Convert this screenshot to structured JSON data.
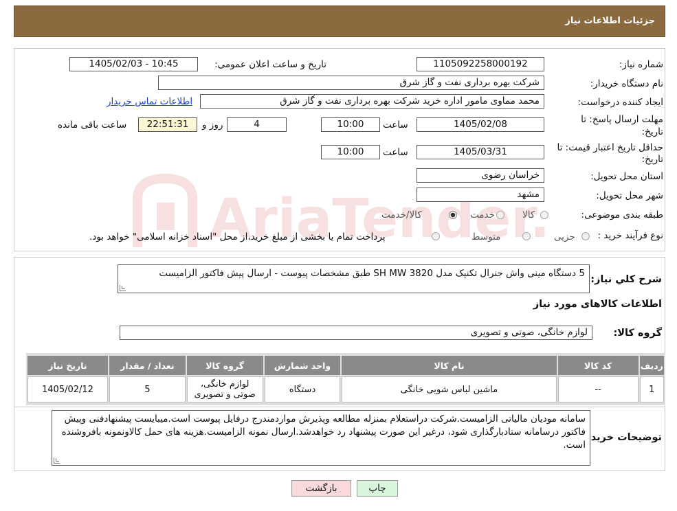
{
  "header": {
    "title": "جزئیات اطلاعات نیاز"
  },
  "watermark": {
    "text": "AriaTender.neT"
  },
  "form": {
    "need_number_label": "شماره نیاز:",
    "need_number": "1105092258000192",
    "announce_label": "تاریخ و ساعت اعلان عمومی:",
    "announce_value": "1405/02/03 - 10:45",
    "buyer_org_label": "نام دستگاه خریدار:",
    "buyer_org": "شرکت بهره برداری نفت و گاز شرق",
    "creator_label": "ایجاد کننده درخواست:",
    "creator": "محمد مماوی مامور اداره خرید شرکت بهره برداری نفت و گاز شرق",
    "contact_link": "اطلاعات تماس خریدار",
    "reply_deadline_label_1": "مهلت ارسال پاسخ: تا",
    "reply_deadline_label_2": "تاریخ:",
    "reply_date": "1405/02/08",
    "time_label": "ساعت",
    "reply_time": "10:00",
    "days_value": "4",
    "days_label": "روز و",
    "remaining_time": "22:51:31",
    "remaining_label": "ساعت باقی مانده",
    "validity_label_1": "حداقل تاریخ اعتبار قیمت: تا",
    "validity_label_2": "تاریخ:",
    "validity_date": "1405/03/31",
    "validity_time": "10:00",
    "province_label": "استان محل تحویل:",
    "province": "خراسان رضوی",
    "city_label": "شهر محل تحویل:",
    "city": "مشهد",
    "category_label": "طبقه بندی موضوعی:",
    "category_options": [
      "کالا",
      "خدمت",
      "کالا/خدمت"
    ],
    "process_label": "نوع فرآیند خرید :",
    "process_options": [
      "جزیی",
      "متوسط"
    ],
    "process_note": "پرداخت تمام یا بخشی از مبلغ خرید،از محل \"اسناد خزانه اسلامی\" خواهد بود."
  },
  "description": {
    "label": "شرح کلي نياز:",
    "text": "5 دستگاه مینی واش جنرال تکنیک مدل SH MW 3820 طبق مشخصات پیوست - ارسال پیش فاکتور الزامیست"
  },
  "goods": {
    "section_title": "اطلاعات کالاهای مورد نیاز",
    "group_label": "گروه کالا:",
    "group_value": "لوازم خانگی، صوتی و تصویری",
    "columns": [
      "ردیف",
      "کد کالا",
      "نام کالا",
      "واحد شمارش",
      "گروه کالا",
      "تعداد / مقدار",
      "تاریخ نیاز"
    ],
    "rows": [
      [
        "1",
        "--",
        "ماشین لباس شویی خانگی",
        "دستگاه",
        "لوازم خانگی، صوتی و تصویری",
        "5",
        "1405/02/12"
      ]
    ]
  },
  "buyer_notes": {
    "label": "توضیحات خریدار:",
    "text": "سامانه مودیان مالیاتی الزامیست.شرکت دراستعلام بمنزله مطالعه وپذیرش مواردمندرج درفایل پیوست است.میبایست پیشنهادفنی وپیش فاکتور درسامانه ستادبارگذاری شود، درغیر این صورت پیشنهاد رد خواهدشد.ارسال نمونه الزامیست.هزینه های حمل کالاونمونه بافروشنده است."
  },
  "buttons": {
    "print": "چاپ",
    "back": "بازگشت"
  },
  "colors": {
    "header": "#8b6a3f",
    "table_header": "#8a8a8a",
    "back_button": "#f9d9dc",
    "print_button": "#d9f5dc",
    "link": "#1d3fd6"
  }
}
